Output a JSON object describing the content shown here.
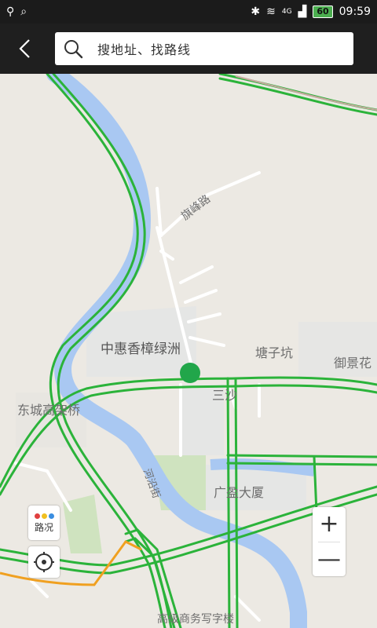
{
  "status_bar": {
    "time": "09:59",
    "battery": "60",
    "network": "4G"
  },
  "toolbar": {
    "back_label": "返回",
    "search_placeholder": "搜地址、找路线"
  },
  "map": {
    "labels": {
      "qifeng_road": "旗峰路",
      "zhonghui": "中惠香樟绿洲",
      "tangzikeng": "塘子坑",
      "yujinghua": "御景花",
      "sansha": "三沙",
      "dongcheng_bridge": "东城高架桥",
      "hexi_road": "河沿街",
      "guangying": "广盈大厦",
      "office_building": "高级商务写字楼"
    },
    "controls": {
      "traffic_label": "路况",
      "zoom_in": "+",
      "zoom_out": "—"
    },
    "colors": {
      "road_green": "#2bb33a",
      "road_orange": "#f0a020",
      "river": "#a9c8f2",
      "park": "#cfe3bf"
    }
  }
}
